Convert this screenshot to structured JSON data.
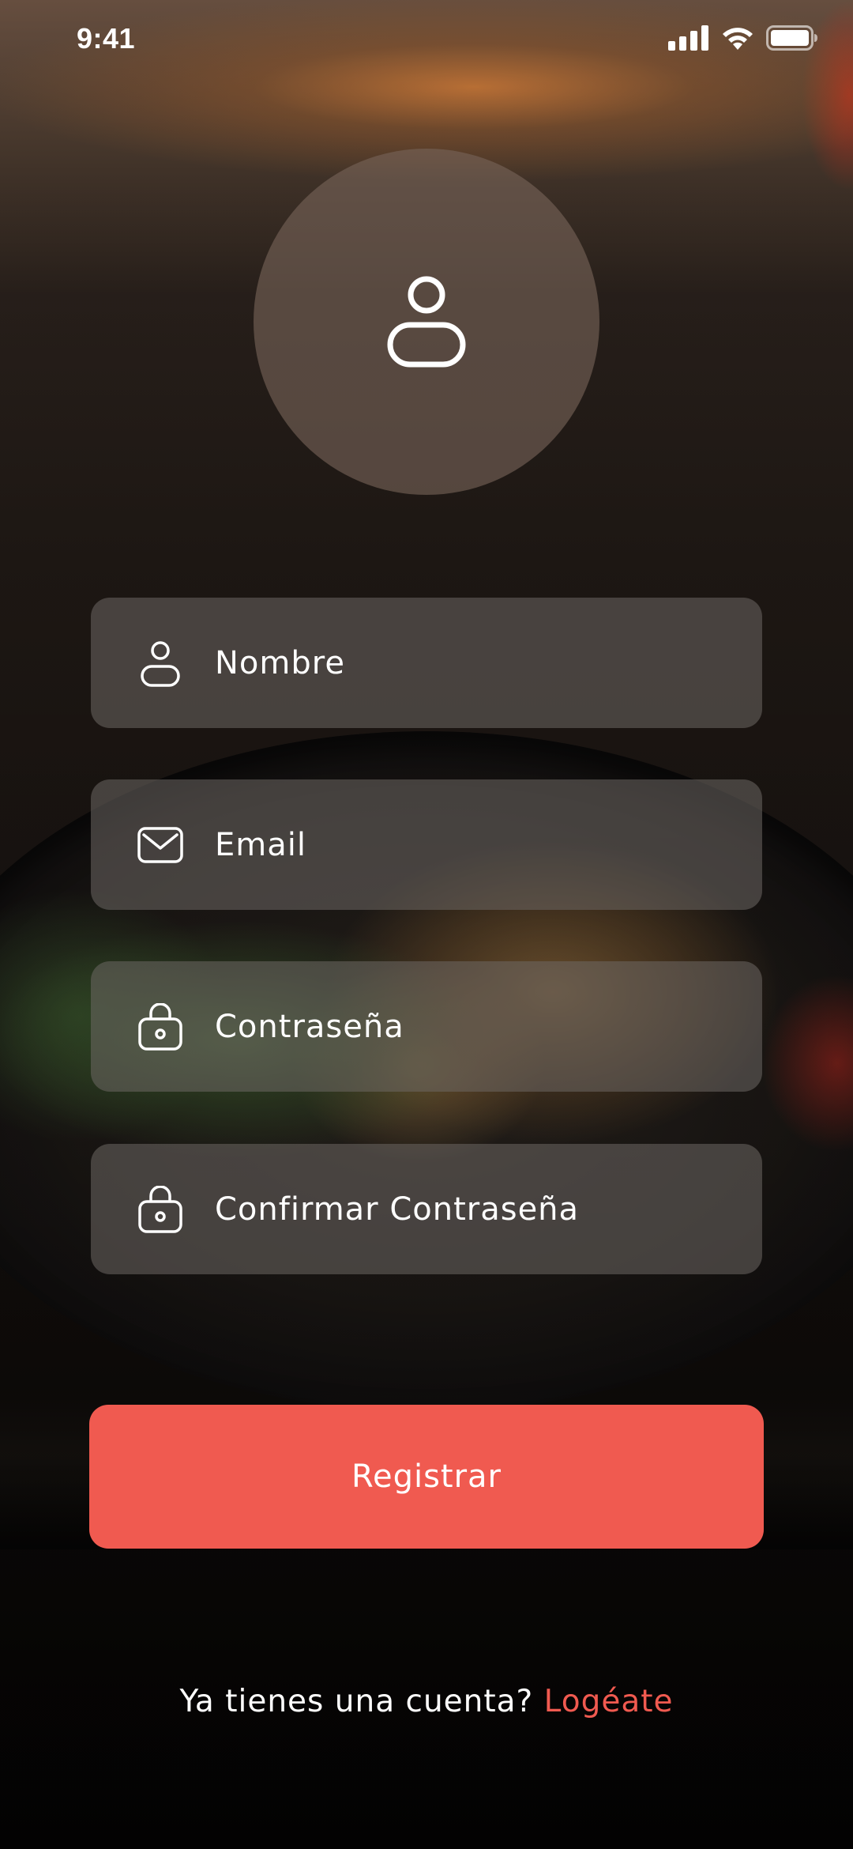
{
  "status_bar": {
    "time": "9:41",
    "icons": [
      "cellular-signal-icon",
      "wifi-icon",
      "battery-icon"
    ]
  },
  "avatar": {
    "icon": "user-icon"
  },
  "form": {
    "fields": [
      {
        "icon": "user-icon",
        "placeholder": "Nombre"
      },
      {
        "icon": "mail-icon",
        "placeholder": "Email"
      },
      {
        "icon": "lock-icon",
        "placeholder": "Contraseña"
      },
      {
        "icon": "lock-icon",
        "placeholder": "Confirmar Contraseña"
      }
    ],
    "submit_label": "Registrar"
  },
  "footer": {
    "prompt": "Ya tienes una cuenta?",
    "link_label": "Logéate"
  },
  "colors": {
    "accent": "#f05a50",
    "field_bg": "#6e6864",
    "text": "#ffffff"
  }
}
